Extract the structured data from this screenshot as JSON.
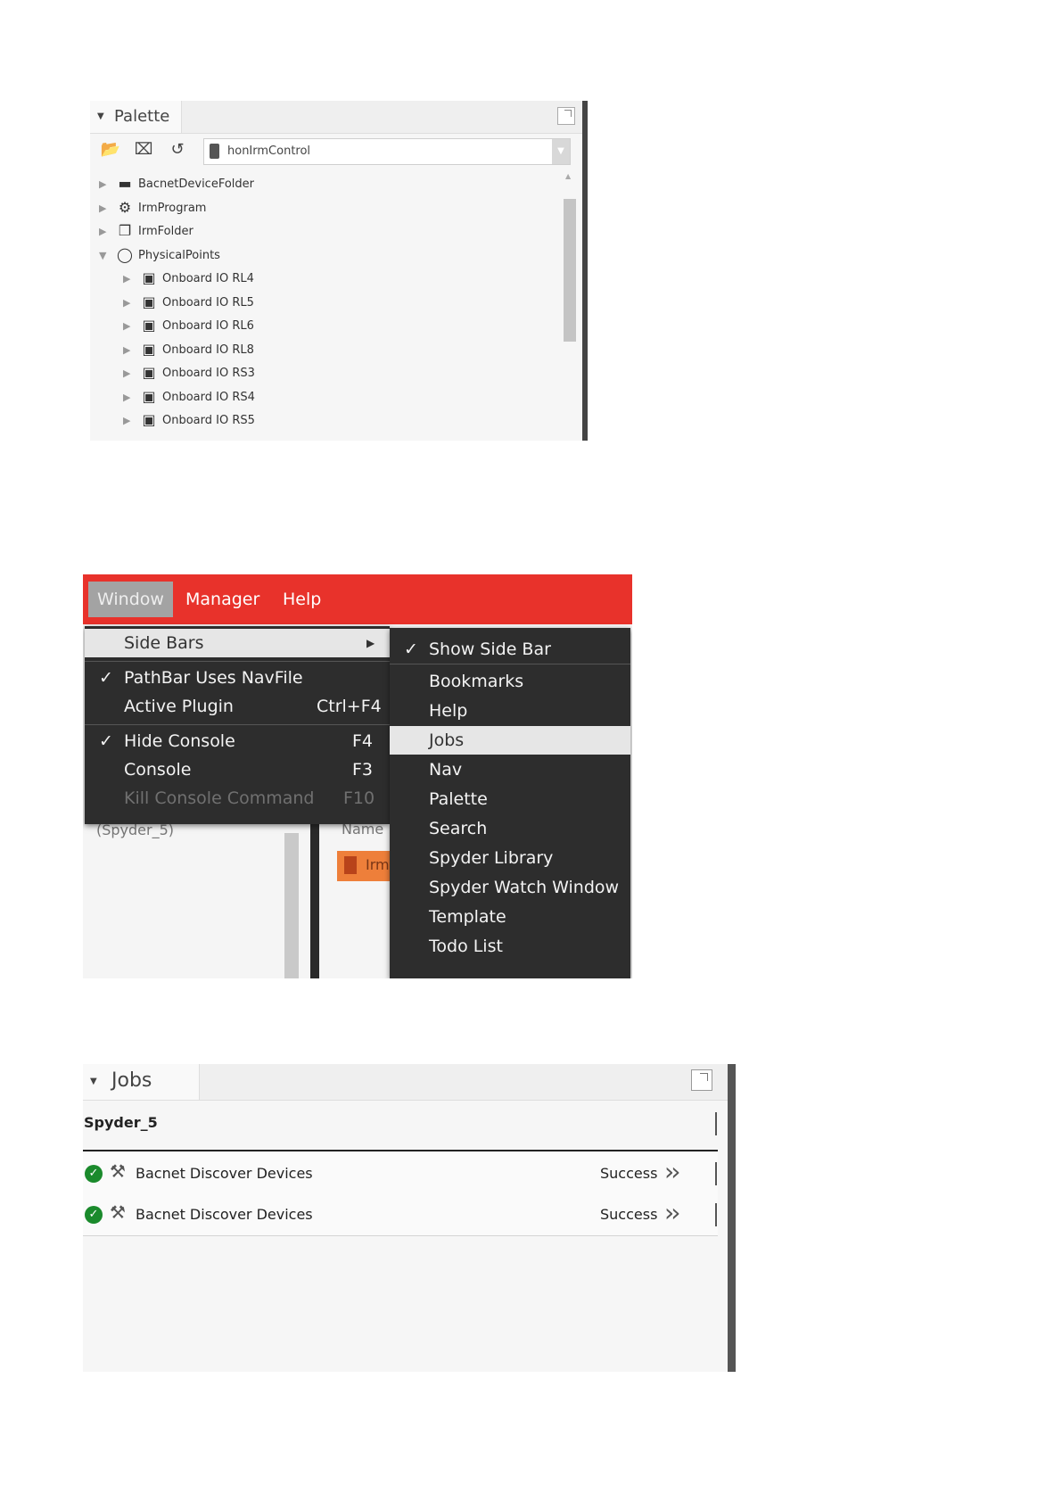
{
  "palette": {
    "title": "Palette",
    "toolbar": {
      "open_icon": "folder-open-icon",
      "close_icon": "close-box-icon",
      "find_icon": "refresh-search-icon"
    },
    "module": "honIrmControl",
    "tree": [
      {
        "label": "BacnetDeviceFolder",
        "icon": "folder-icon",
        "expanded": false,
        "level": 0
      },
      {
        "label": "IrmProgram",
        "icon": "program-icon",
        "expanded": false,
        "level": 0
      },
      {
        "label": "IrmFolder",
        "icon": "folder-doc-icon",
        "expanded": false,
        "level": 0
      },
      {
        "label": "PhysicalPoints",
        "icon": "circle-icon",
        "expanded": true,
        "level": 0
      },
      {
        "label": "Onboard IO RL4",
        "icon": "io-icon",
        "expanded": false,
        "level": 1
      },
      {
        "label": "Onboard IO RL5",
        "icon": "io-icon",
        "expanded": false,
        "level": 1
      },
      {
        "label": "Onboard IO RL6",
        "icon": "io-icon",
        "expanded": false,
        "level": 1
      },
      {
        "label": "Onboard IO RL8",
        "icon": "io-icon",
        "expanded": false,
        "level": 1
      },
      {
        "label": "Onboard IO RS3",
        "icon": "io-icon",
        "expanded": false,
        "level": 1
      },
      {
        "label": "Onboard IO RS4",
        "icon": "io-icon",
        "expanded": false,
        "level": 1
      },
      {
        "label": "Onboard IO RS5",
        "icon": "io-icon",
        "expanded": false,
        "level": 1
      }
    ]
  },
  "menu": {
    "bar": [
      "Window",
      "Manager",
      "Help"
    ],
    "background": {
      "station": "(Spyder_5)",
      "name_header": "Name",
      "item": "Irm"
    },
    "window_menu": [
      {
        "label": "Side Bars",
        "submenu": true,
        "highlighted": true
      },
      {
        "label": "PathBar Uses NavFile",
        "checked": true
      },
      {
        "label": "Active Plugin",
        "shortcut": "Ctrl+F4"
      },
      {
        "label": "Hide Console",
        "checked": true,
        "shortcut": "F4"
      },
      {
        "label": "Console",
        "shortcut": "F3"
      },
      {
        "label": "Kill Console Command",
        "shortcut": "F10",
        "disabled": true
      }
    ],
    "sidebars_menu": [
      {
        "label": "Show Side Bar",
        "checked": true
      },
      {
        "label": "Bookmarks"
      },
      {
        "label": "Help"
      },
      {
        "label": "Jobs",
        "highlighted": true
      },
      {
        "label": "Nav"
      },
      {
        "label": "Palette"
      },
      {
        "label": "Search"
      },
      {
        "label": "Spyder Library"
      },
      {
        "label": "Spyder Watch Window"
      },
      {
        "label": "Template"
      },
      {
        "label": "Todo List"
      }
    ],
    "colors": {
      "menubar": "#e8322b",
      "menu_bg": "#2d2d2d",
      "highlight": "#e6e6e6"
    }
  },
  "jobs": {
    "title": "Jobs",
    "station": "Spyder_5",
    "rows": [
      {
        "label": "Bacnet Discover Devices",
        "status": "Success",
        "icon": "check-circle-icon"
      },
      {
        "label": "Bacnet Discover Devices",
        "status": "Success",
        "icon": "check-circle-icon"
      }
    ]
  }
}
